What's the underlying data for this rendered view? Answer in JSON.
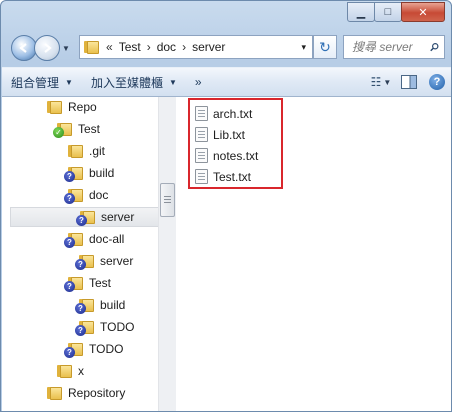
{
  "window": {
    "caption_buttons": {
      "minimize": "▁",
      "maximize": "□",
      "close": "✕"
    }
  },
  "address": {
    "overflow": "«",
    "breadcrumbs": [
      "Test",
      "doc",
      "server"
    ],
    "separator": "›",
    "dropdown": "▾"
  },
  "refresh": {
    "icon": "refresh-icon",
    "glyph": "↻"
  },
  "search": {
    "placeholder": "搜尋 server"
  },
  "toolbar": {
    "organize_label": "組合管理",
    "add_to_library_label": "加入至媒體櫃",
    "more_label": "»",
    "view_glyph": "☷",
    "help_glyph": "?"
  },
  "nav_tree": [
    {
      "label": "Repo",
      "badge": ""
    },
    {
      "label": "Test",
      "badge": "ok"
    },
    {
      "label": ".git",
      "badge": ""
    },
    {
      "label": "build",
      "badge": "question"
    },
    {
      "label": "doc",
      "badge": "question"
    },
    {
      "label": "server",
      "badge": "question",
      "selected": true
    },
    {
      "label": "doc-all",
      "badge": "question"
    },
    {
      "label": "server",
      "badge": "question"
    },
    {
      "label": "Test",
      "badge": "question"
    },
    {
      "label": "build",
      "badge": "question"
    },
    {
      "label": "TODO",
      "badge": "question"
    },
    {
      "label": "TODO",
      "badge": "question"
    },
    {
      "label": "x",
      "badge": ""
    },
    {
      "label": "Repository",
      "badge": ""
    }
  ],
  "files": [
    "arch.txt",
    "Lib.txt",
    "notes.txt",
    "Test.txt"
  ],
  "colors": {
    "highlight_border": "#d9262c",
    "folder": "#e9c04e",
    "window_frame": "#b7cde6"
  }
}
